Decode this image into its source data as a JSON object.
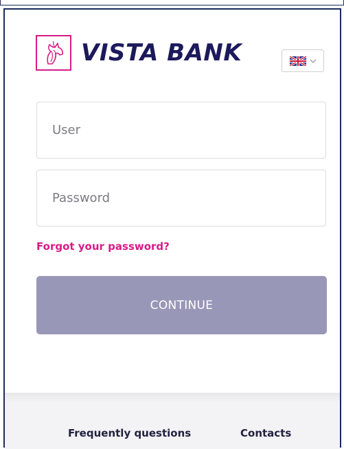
{
  "brand": {
    "name": "VISTA BANK",
    "logo_icon": "horse-head-icon",
    "accent_color": "#d81b87",
    "brand_color": "#1c1a5c"
  },
  "language_selector": {
    "flag_icon": "uk-flag-icon",
    "chevron_icon": "chevron-down-icon"
  },
  "login_form": {
    "user_placeholder": "User",
    "password_placeholder": "Password",
    "forgot_link": "Forgot your password?",
    "continue_label": "CONTINUE",
    "continue_color": "#9997b7"
  },
  "footer": {
    "links": [
      {
        "label": "Frequently questions"
      },
      {
        "label": "Contacts"
      }
    ]
  }
}
